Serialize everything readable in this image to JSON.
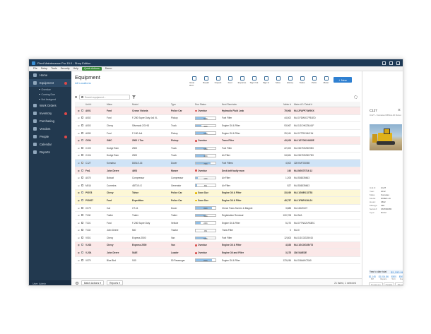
{
  "window": {
    "title": "Fleet Maintenance Pro 15.0 - Shop Edition"
  },
  "menu": {
    "items": [
      "File",
      "Setup",
      "Tools",
      "Security",
      "Help"
    ],
    "quick_action": "Quick Actions",
    "demo": "Demo"
  },
  "sidebar": {
    "items": [
      {
        "label": "Home",
        "icon": "home-icon",
        "badge": false
      },
      {
        "label": "Equipment",
        "icon": "truck-icon",
        "badge": true,
        "active": true
      },
      {
        "label": "Work Orders",
        "icon": "clipboard-icon",
        "badge": false
      },
      {
        "label": "Inventory",
        "icon": "box-icon",
        "badge": true
      },
      {
        "label": "Purchasing",
        "icon": "cart-icon",
        "badge": false
      },
      {
        "label": "Vendors",
        "icon": "store-icon",
        "badge": false
      },
      {
        "label": "People",
        "icon": "people-icon",
        "badge": true
      },
      {
        "label": "Calendar",
        "icon": "calendar-icon",
        "badge": false
      },
      {
        "label": "Reports",
        "icon": "chart-icon",
        "badge": false
      }
    ],
    "subitems": [
      "Overdue",
      "Coming Due",
      "Not Assigned"
    ],
    "footer": "User: Admin"
  },
  "header": {
    "title": "Equipment",
    "subtitle": "All Locations"
  },
  "toolbar": {
    "buttons": [
      {
        "label": "Issue W.O.",
        "icon": "wrench-icon"
      },
      {
        "label": "Repair",
        "icon": "repair-icon"
      },
      {
        "label": "Inspect",
        "icon": "inspect-icon"
      },
      {
        "label": "Fuel",
        "icon": "fuel-icon"
      },
      {
        "label": "Expense",
        "icon": "expense-icon"
      },
      {
        "label": "Sign Out",
        "icon": "signout-icon"
      },
      {
        "label": "Sign In",
        "icon": "signin-icon"
      },
      {
        "label": "More",
        "icon": "more-icon"
      },
      {
        "label": "History",
        "icon": "history-icon"
      },
      {
        "label": "Tasks",
        "icon": "tasks-icon"
      },
      {
        "label": "Parts",
        "icon": "parts-icon"
      },
      {
        "label": "Meter",
        "icon": "meter-icon"
      }
    ],
    "new_label": "+ New"
  },
  "search": {
    "placeholder": "Search equipment..."
  },
  "columns": [
    "Unit #",
    "Make",
    "Model",
    "Type",
    "Due Status",
    "Next Reminder",
    "Meter #",
    "Meter #2 / Detail #"
  ],
  "rows": [
    {
      "unit": "A001",
      "make": "Ford",
      "model": "Crown Victoria",
      "type": "Police Car",
      "status": "Overdue",
      "kind": "red",
      "reminder": "Hydraulic Fluid Leak",
      "meter": "75,964",
      "detail": "N/A 2FAFP74W9XX"
    },
    {
      "unit": "A002",
      "make": "Ford",
      "model": "F-250 Super Duty 4x4 XL",
      "type": "Pickup",
      "status": "50%",
      "pct": 0.5,
      "kind": "",
      "reminder": "Fuel Filter",
      "meter": "44,502",
      "detail": "N/A 1FDWX37F51ED"
    },
    {
      "unit": "A003",
      "make": "Chevy",
      "model": "Silverado 2/3 HD",
      "type": "Truck",
      "status": "30%",
      "pct": 0.3,
      "kind": "",
      "reminder": "Engine Oil & Filter",
      "meter": "93,967",
      "detail": "N/A 1GCHK23U41F"
    },
    {
      "unit": "A005",
      "make": "Ford",
      "model": "F-150 4x4",
      "type": "Pickup",
      "status": "52%",
      "pct": 0.52,
      "kind": "",
      "reminder": "Engine Oil & Filter",
      "meter": "25,341",
      "detail": "N/A 1FTRX18L21N"
    },
    {
      "unit": "C054",
      "make": "GMC",
      "model": "2500 1 Ton",
      "type": "Pickup",
      "status": "Overdue",
      "kind": "red",
      "reminder": "Trans Filter",
      "meter": "43,209",
      "detail": "N/A 1GTGK24U82E"
    },
    {
      "unit": "C100",
      "make": "Dodge Ram",
      "model": "2500",
      "type": "Truck",
      "status": "55%",
      "pct": 0.55,
      "kind": "",
      "reminder": "Fuel Filter",
      "meter": "22,000",
      "detail": "N/A 3D7KS28C95G"
    },
    {
      "unit": "C104",
      "make": "Dodge Ram",
      "model": "2500",
      "type": "Truck",
      "status": "46%",
      "pct": 0.46,
      "kind": "",
      "reminder": "Air Filter",
      "meter": "34,561",
      "detail": "N/A 3D7KS28C75G"
    },
    {
      "unit": "C127",
      "make": "Komatsu",
      "model": "D65LE-16",
      "type": "Dozer",
      "status": "74%",
      "pct": 0.74,
      "kind": "blue",
      "reminder": "Fuel Filters",
      "meter": "4,502",
      "detail": "328 KMT0D065"
    },
    {
      "unit": "Fm1",
      "make": "John Deere",
      "model": "4WD",
      "type": "Mower",
      "status": "Overdue",
      "kind": "red",
      "reminder": "Deck belt faulty mow",
      "meter": "240",
      "detail": "N/A M0X75716 12"
    },
    {
      "unit": "A078",
      "make": "Bobcat",
      "model": "Compressor",
      "type": "Compressor",
      "status": "10%",
      "pct": 0.1,
      "kind": "",
      "reminder": "Air Filter",
      "meter": "1,205",
      "detail": "N/A 536039463"
    },
    {
      "unit": "M014",
      "make": "Cummins",
      "model": "4BT3.9-G",
      "type": "Generator",
      "status": "8%",
      "pct": 0.08,
      "kind": "",
      "reminder": "Air Filter",
      "meter": "827",
      "detail": "N/A 536039463"
    },
    {
      "unit": "P0078",
      "make": "Chevy",
      "model": "Tahoe",
      "type": "Police Car",
      "status": "Soon Due",
      "kind": "yellow",
      "reminder": "Engine Oil & Filter",
      "meter": "33,939",
      "detail": "N/A 1GNEK13T53"
    },
    {
      "unit": "P00307",
      "make": "Ford",
      "model": "Expedition",
      "type": "Police Car",
      "status": "Soon Due",
      "kind": "yellow",
      "reminder": "Engine Oil & Filter",
      "meter": "48,757",
      "detail": "N/A 1FMPU16L24"
    },
    {
      "unit": "C079",
      "make": "Cat",
      "model": "CT-11",
      "type": "Dozer",
      "status": "82%",
      "pct": 0.82,
      "kind": "",
      "reminder": "Check Trans Screen & Magnet",
      "meter": "3,888",
      "detail": "N/A 4DZ0107"
    },
    {
      "unit": "T100",
      "make": "Trailer",
      "model": "Trailer",
      "type": "Trailer",
      "status": "50%",
      "pct": 0.5,
      "kind": "",
      "reminder": "Registration Renewal",
      "meter": "100,708",
      "detail": "N/A N/A"
    },
    {
      "unit": "T101",
      "make": "Ford",
      "model": "F-250 Super Duty",
      "type": "Vehicle",
      "status": "24%",
      "pct": 0.24,
      "kind": "",
      "reminder": "Engine Oil & Filter",
      "meter": "5,270",
      "detail": "N/A 1FTNX21F63EC"
    },
    {
      "unit": "T102",
      "make": "John Deere",
      "model": "540",
      "type": "Tractor",
      "status": "0%",
      "pct": 0.0,
      "kind": "",
      "reminder": "Trans Filter",
      "meter": "0",
      "detail": "N/A 0"
    },
    {
      "unit": "V001",
      "make": "Chevy",
      "model": "Express 2500",
      "type": "Van",
      "status": "53%",
      "pct": 0.53,
      "kind": "",
      "reminder": "Fuel Filter",
      "meter": "12,803",
      "detail": "N/A 1GCGG25V43"
    },
    {
      "unit": "V-002",
      "make": "Chevy",
      "model": "Express 2500",
      "type": "Van",
      "status": "Overdue",
      "kind": "red",
      "reminder": "Engine Oil & Filter",
      "meter": "4,526",
      "detail": "N/A 1GCGG25V73"
    },
    {
      "unit": "V-204",
      "make": "John Deere",
      "model": "544E",
      "type": "Loader",
      "status": "Overdue",
      "kind": "red",
      "reminder": "Engine Oil and Filter",
      "meter": "3,375",
      "detail": "336 544EDE"
    },
    {
      "unit": "V079",
      "make": "Blue Bird",
      "model": "S40",
      "type": "50 Passenger",
      "status": "81%",
      "pct": 0.81,
      "kind": "",
      "reminder": "Engine Oil & Filter",
      "meter": "123,456",
      "detail": "N/A 1BAAKCSA0"
    }
  ],
  "bottom": {
    "batch": "Batch Actions",
    "reports": "Reports",
    "status": "21 listed, 1 selected"
  },
  "detail": {
    "unit": "C127",
    "subtitle": "C127 - Komatsu D65LE-16 Dozer",
    "props": [
      {
        "k": "Unit #:",
        "v": "C127"
      },
      {
        "k": "Year:",
        "v": "2012"
      },
      {
        "k": "Make:",
        "v": "Komatsu"
      },
      {
        "k": "Model:",
        "v": "D65EX-16"
      },
      {
        "k": "Hours:",
        "v": "4502"
      },
      {
        "k": "Mileage:",
        "v": "328"
      },
      {
        "k": "Serial #:",
        "v": "KMT0D065"
      },
      {
        "k": "Type:",
        "v": "Dozer"
      }
    ],
    "ytd_label": "Year to date total:",
    "ytd_value": "$1,153.96",
    "stats": [
      {
        "v": "$1,145",
        "l": "PM"
      },
      {
        "v": "$1,014.86",
        "l": "Repairs"
      },
      {
        "v": "$500",
        "l": "W.O."
      },
      {
        "v": "$500",
        "l": "Fuel"
      }
    ],
    "tabs": [
      "Summary",
      "Details",
      "Attachments"
    ]
  },
  "colors": {
    "sidebar": "#22394f",
    "accent": "#2f80d1",
    "overdue": "#d9534f",
    "soon_due": "#e6b800"
  }
}
